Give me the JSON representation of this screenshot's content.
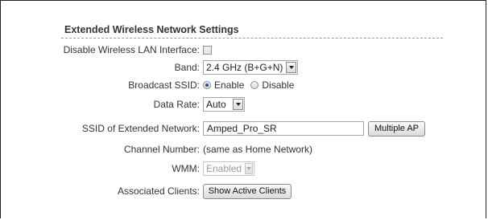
{
  "section": {
    "title": "Extended Wireless Network Settings"
  },
  "rows": {
    "disable_wlan": {
      "label": "Disable Wireless LAN Interface:",
      "checked": false
    },
    "band": {
      "label": "Band:",
      "selected": "2.4 GHz (B+G+N)"
    },
    "broadcast_ssid": {
      "label": "Broadcast SSID:",
      "option_enable": "Enable",
      "option_disable": "Disable",
      "selected": "Enable"
    },
    "data_rate": {
      "label": "Data Rate:",
      "selected": "Auto"
    },
    "ssid": {
      "label": "SSID of Extended Network:",
      "value": "Amped_Pro_SR",
      "button": "Multiple AP"
    },
    "channel": {
      "label": "Channel Number:",
      "value": "(same as Home Network)"
    },
    "wmm": {
      "label": "WMM:",
      "selected": "Enabled",
      "disabled": true
    },
    "clients": {
      "label": "Associated Clients:",
      "button": "Show Active Clients"
    }
  }
}
